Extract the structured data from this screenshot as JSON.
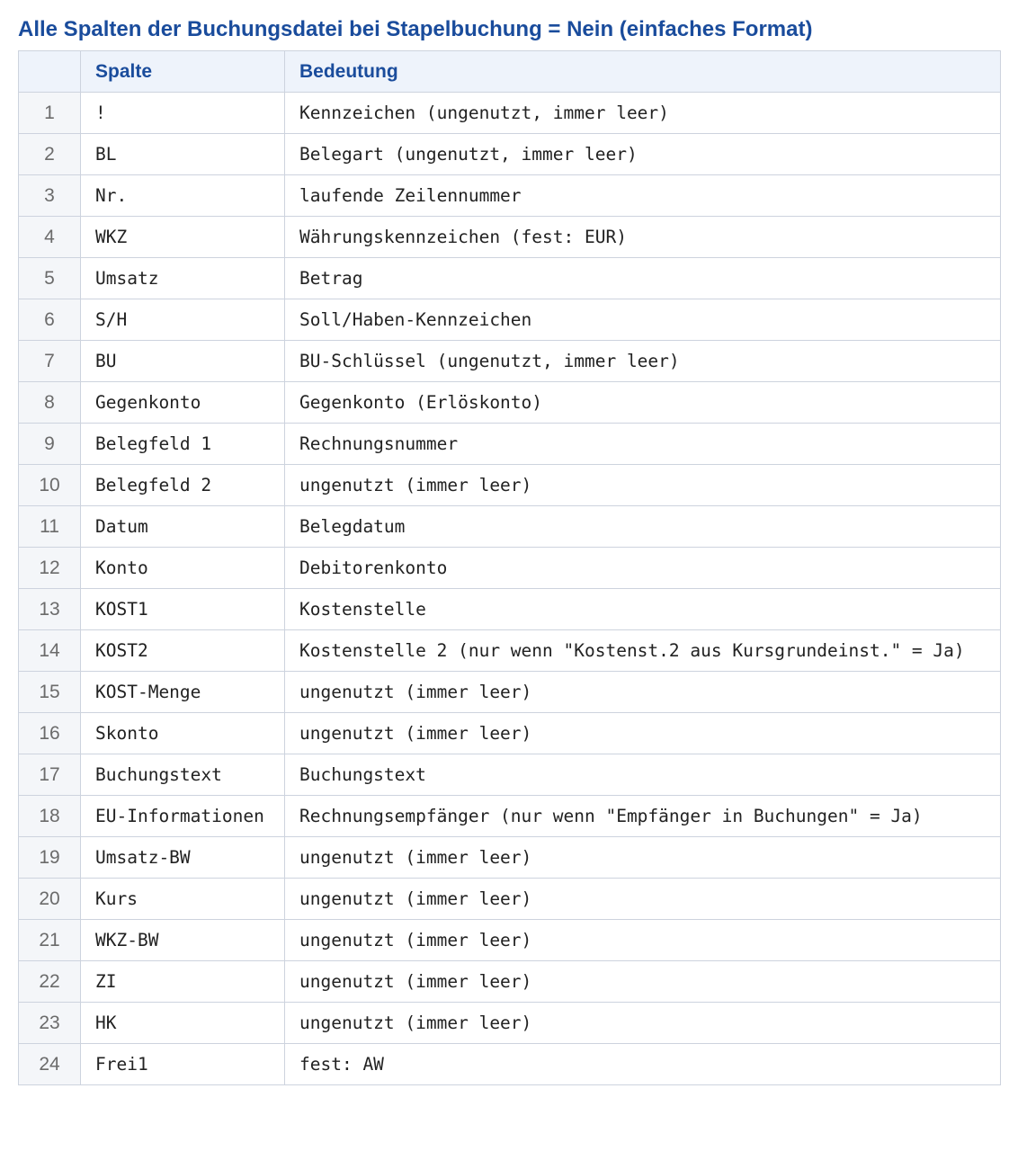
{
  "title": "Alle Spalten der Buchungsdatei bei Stapelbuchung = Nein (einfaches Format)",
  "table": {
    "headers": [
      "",
      "Spalte",
      "Bedeutung"
    ],
    "rows": [
      {
        "num": "1",
        "spalte": "!",
        "bedeutung": "Kennzeichen (ungenutzt, immer leer)"
      },
      {
        "num": "2",
        "spalte": "BL",
        "bedeutung": "Belegart (ungenutzt, immer leer)"
      },
      {
        "num": "3",
        "spalte": "Nr.",
        "bedeutung": "laufende Zeilennummer"
      },
      {
        "num": "4",
        "spalte": "WKZ",
        "bedeutung": "Währungskennzeichen (fest: EUR)"
      },
      {
        "num": "5",
        "spalte": "Umsatz",
        "bedeutung": "Betrag"
      },
      {
        "num": "6",
        "spalte": "S/H",
        "bedeutung": "Soll/Haben-Kennzeichen"
      },
      {
        "num": "7",
        "spalte": "BU",
        "bedeutung": "BU-Schlüssel (ungenutzt, immer leer)"
      },
      {
        "num": "8",
        "spalte": "Gegenkonto",
        "bedeutung": "Gegenkonto (Erlöskonto)"
      },
      {
        "num": "9",
        "spalte": "Belegfeld 1",
        "bedeutung": "Rechnungsnummer"
      },
      {
        "num": "10",
        "spalte": "Belegfeld 2",
        "bedeutung": "ungenutzt (immer leer)"
      },
      {
        "num": "11",
        "spalte": "Datum",
        "bedeutung": "Belegdatum"
      },
      {
        "num": "12",
        "spalte": "Konto",
        "bedeutung": "Debitorenkonto"
      },
      {
        "num": "13",
        "spalte": "KOST1",
        "bedeutung": "Kostenstelle"
      },
      {
        "num": "14",
        "spalte": "KOST2",
        "bedeutung": "Kostenstelle 2 (nur wenn \"Kostenst.2 aus Kursgrundeinst.\" = Ja)"
      },
      {
        "num": "15",
        "spalte": "KOST-Menge",
        "bedeutung": "ungenutzt (immer leer)"
      },
      {
        "num": "16",
        "spalte": "Skonto",
        "bedeutung": "ungenutzt (immer leer)"
      },
      {
        "num": "17",
        "spalte": "Buchungstext",
        "bedeutung": "Buchungstext"
      },
      {
        "num": "18",
        "spalte": "EU-Informationen",
        "bedeutung": "Rechnungsempfänger (nur wenn \"Empfänger in Buchungen\" = Ja)"
      },
      {
        "num": "19",
        "spalte": "Umsatz-BW",
        "bedeutung": "ungenutzt (immer leer)"
      },
      {
        "num": "20",
        "spalte": "Kurs",
        "bedeutung": "ungenutzt (immer leer)"
      },
      {
        "num": "21",
        "spalte": "WKZ-BW",
        "bedeutung": "ungenutzt (immer leer)"
      },
      {
        "num": "22",
        "spalte": "ZI",
        "bedeutung": "ungenutzt (immer leer)"
      },
      {
        "num": "23",
        "spalte": "HK",
        "bedeutung": "ungenutzt (immer leer)"
      },
      {
        "num": "24",
        "spalte": "Frei1",
        "bedeutung": "fest: AW"
      }
    ]
  },
  "colors": {
    "title": "#1a4c9c",
    "header_bg": "#eef3fb",
    "border": "#cdd3de"
  }
}
